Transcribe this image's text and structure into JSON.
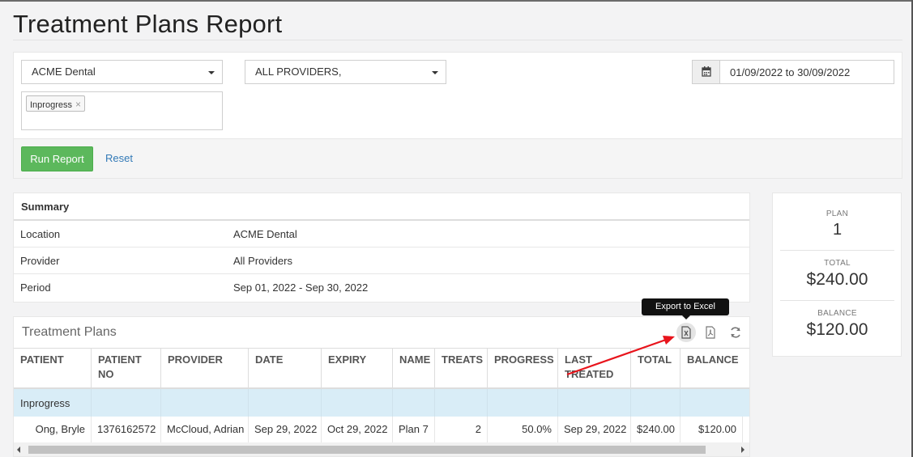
{
  "page": {
    "title": "Treatment Plans Report"
  },
  "filters": {
    "location": "ACME Dental",
    "provider": "ALL PROVIDERS,",
    "status_tag": "Inprogress",
    "tag_remove": "×",
    "date_range": "01/09/2022 to 30/09/2022",
    "run_label": "Run Report",
    "reset_label": "Reset"
  },
  "summary": {
    "heading": "Summary",
    "rows": [
      {
        "label": "Location",
        "value": "ACME Dental"
      },
      {
        "label": "Provider",
        "value": "All Providers"
      },
      {
        "label": "Period",
        "value": "Sep 01, 2022 - Sep 30, 2022"
      }
    ]
  },
  "stats": {
    "plan_label": "PLAN",
    "plan_value": "1",
    "total_label": "TOTAL",
    "total_value": "$240.00",
    "balance_label": "BALANCE",
    "balance_value": "$120.00"
  },
  "plans": {
    "title": "Treatment Plans",
    "tooltip": "Export to Excel",
    "columns": [
      {
        "line1": "PATIENT",
        "line2": ""
      },
      {
        "line1": "PATIENT",
        "line2": "NO"
      },
      {
        "line1": "PROVIDER",
        "line2": ""
      },
      {
        "line1": "DATE",
        "line2": ""
      },
      {
        "line1": "EXPIRY",
        "line2": ""
      },
      {
        "line1": "NAME",
        "line2": ""
      },
      {
        "line1": "TREATS",
        "line2": ""
      },
      {
        "line1": "PROGRESS",
        "line2": ""
      },
      {
        "line1": "LAST",
        "line2": "TREATED"
      },
      {
        "line1": "TOTAL",
        "line2": ""
      },
      {
        "line1": "BALANCE",
        "line2": ""
      }
    ],
    "group_label": "Inprogress",
    "rows": [
      {
        "patient": "Ong, Bryle",
        "patient_no": "1376162572",
        "provider": "McCloud, Adrian",
        "date": "Sep 29, 2022",
        "expiry": "Oct 29, 2022",
        "name": "Plan 7",
        "treats": "2",
        "progress": "50.0%",
        "last_treated": "Sep 29, 2022",
        "total": "$240.00",
        "balance": "$120.00"
      }
    ]
  },
  "colors": {
    "accent": "#5cb85c",
    "link": "#337ab7",
    "group_row": "#d9edf7",
    "annotation_arrow": "#e8141c"
  }
}
